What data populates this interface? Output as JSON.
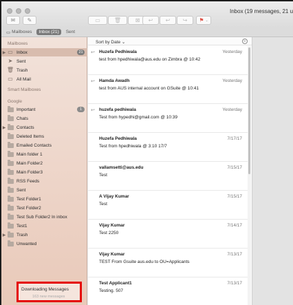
{
  "window": {
    "title": "Inbox (19 messages, 21 un"
  },
  "toolbar": {
    "buttons": [
      {
        "name": "get-mail-icon",
        "glyph": "✉"
      },
      {
        "name": "compose-icon",
        "glyph": "✎"
      },
      {
        "name": "archive-icon",
        "glyph": "▭"
      },
      {
        "name": "delete-icon",
        "glyph": "🗑"
      },
      {
        "name": "junk-icon",
        "glyph": "⊠"
      },
      {
        "name": "reply-icon",
        "glyph": "↩"
      },
      {
        "name": "reply-all-icon",
        "glyph": "↩"
      },
      {
        "name": "forward-icon",
        "glyph": "↪"
      },
      {
        "name": "flag-icon",
        "glyph": "⚑"
      }
    ]
  },
  "favorites": {
    "mailboxes": "Mailboxes",
    "inbox": "Inbox (21)",
    "sent": "Sent"
  },
  "sidebar": {
    "mailboxes_header": "Mailboxes",
    "smart_header": "Smart Mailboxes",
    "google_header": "Google",
    "mailboxes": [
      {
        "label": "Inbox",
        "icon": "inbox-icon",
        "glyph": "▭",
        "badge": "21",
        "disclosure": "▶"
      },
      {
        "label": "Sent",
        "icon": "sent-icon",
        "glyph": "➤"
      },
      {
        "label": "Trash",
        "icon": "trash-icon",
        "glyph": "🗑"
      },
      {
        "label": "All Mail",
        "icon": "all-mail-icon",
        "glyph": "▭"
      }
    ],
    "google": [
      {
        "label": "Important",
        "badge": "1"
      },
      {
        "label": "Chats"
      },
      {
        "label": "Contacts",
        "disclosure": "▶"
      },
      {
        "label": "Deleted Items"
      },
      {
        "label": "Emailed Contacts"
      },
      {
        "label": "Main folder 1"
      },
      {
        "label": "Main Folder2"
      },
      {
        "label": "Main Folder3"
      },
      {
        "label": "RSS Feeds"
      },
      {
        "label": "Sent"
      },
      {
        "label": "Test Folder1"
      },
      {
        "label": "Test Folder2"
      },
      {
        "label": "Test Sub Folder2 In inbox"
      },
      {
        "label": "Test1"
      },
      {
        "label": "Trash",
        "disclosure": "▶"
      },
      {
        "label": "Unwanted"
      }
    ]
  },
  "activity": {
    "title": "Downloading Messages",
    "subtitle": "163 new messages"
  },
  "list": {
    "sort_label": "Sort by Date ⌄",
    "messages": [
      {
        "from": "Huzefa Pedhiwala",
        "date": "Yesterday",
        "subject": "test from hpedhiwala@aus.edu on Zimbra @ 10:42",
        "replied": true
      },
      {
        "from": "Hamda Awadh",
        "date": "Yesterday",
        "subject": "test from AUS internal account on GSuite @ 10:41",
        "replied": true
      },
      {
        "from": "huzefa pedhiwala",
        "date": "Yesterday",
        "subject": "Test from hypedhi@gmail.com @ 10:39",
        "replied": true
      },
      {
        "from": "Huzefa Pedhiwala",
        "date": "7/17/17",
        "subject": "Test from hpedhiwala @ 3:10 17/7"
      },
      {
        "from": "vallamsetti@aus.edu",
        "date": "7/15/17",
        "subject": "Test"
      },
      {
        "from": "A Vijay Kumar",
        "date": "7/15/17",
        "subject": "Test"
      },
      {
        "from": "Vijay Kumar",
        "date": "7/14/17",
        "subject": "Test 2250"
      },
      {
        "from": "Vijay Kumar",
        "date": "7/13/17",
        "subject": "TEST From Gsuite aus.edu to OU=Applicants"
      },
      {
        "from": "Test Applicant1",
        "date": "7/13/17",
        "subject": "Testing. 507"
      }
    ]
  }
}
